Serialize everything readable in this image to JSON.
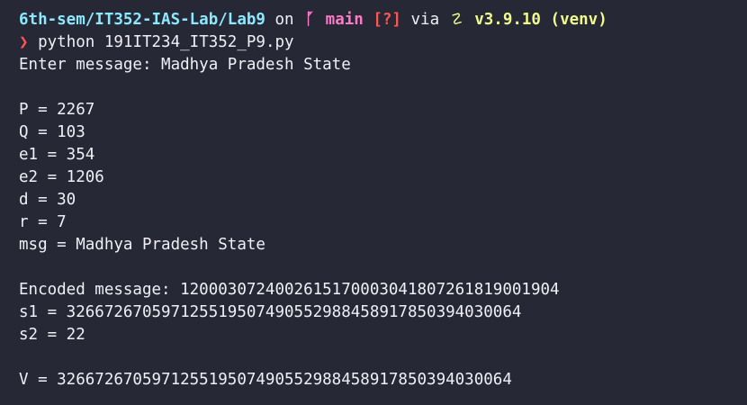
{
  "colors": {
    "background": "#262835",
    "text": "#eef0f6",
    "path": "#8be9fd",
    "branch": "#ff79c6",
    "status": "#ff5555",
    "python": "#f1fa8c",
    "arrow": "#ff5555"
  },
  "prompt": {
    "path": "6th-sem/IT352-IAS-Lab/Lab9",
    "on": "on",
    "branch_icon": "git-branch-icon",
    "branch_glyph": "ᚵ",
    "branch": "main",
    "status": "[?]",
    "via": "via",
    "python_icon": "python-snake-icon",
    "python_glyph": "☡",
    "python_version": "v3.9.10",
    "venv": "(venv)",
    "arrow": "❯",
    "command": "python 191IT234_IT352_P9.py"
  },
  "output": {
    "lines": [
      "Enter message: Madhya Pradesh State",
      "",
      "P = 2267",
      "Q = 103",
      "e1 = 354",
      "e2 = 1206",
      "d = 30",
      "r = 7",
      "msg = Madhya Pradesh State",
      "",
      "Encoded message: 1200030724002615170003041807261819001904",
      "s1 = 326672670597125519507490552988458917850394030064",
      "s2 = 22",
      "",
      "V = 326672670597125519507490552988458917850394030064"
    ]
  }
}
